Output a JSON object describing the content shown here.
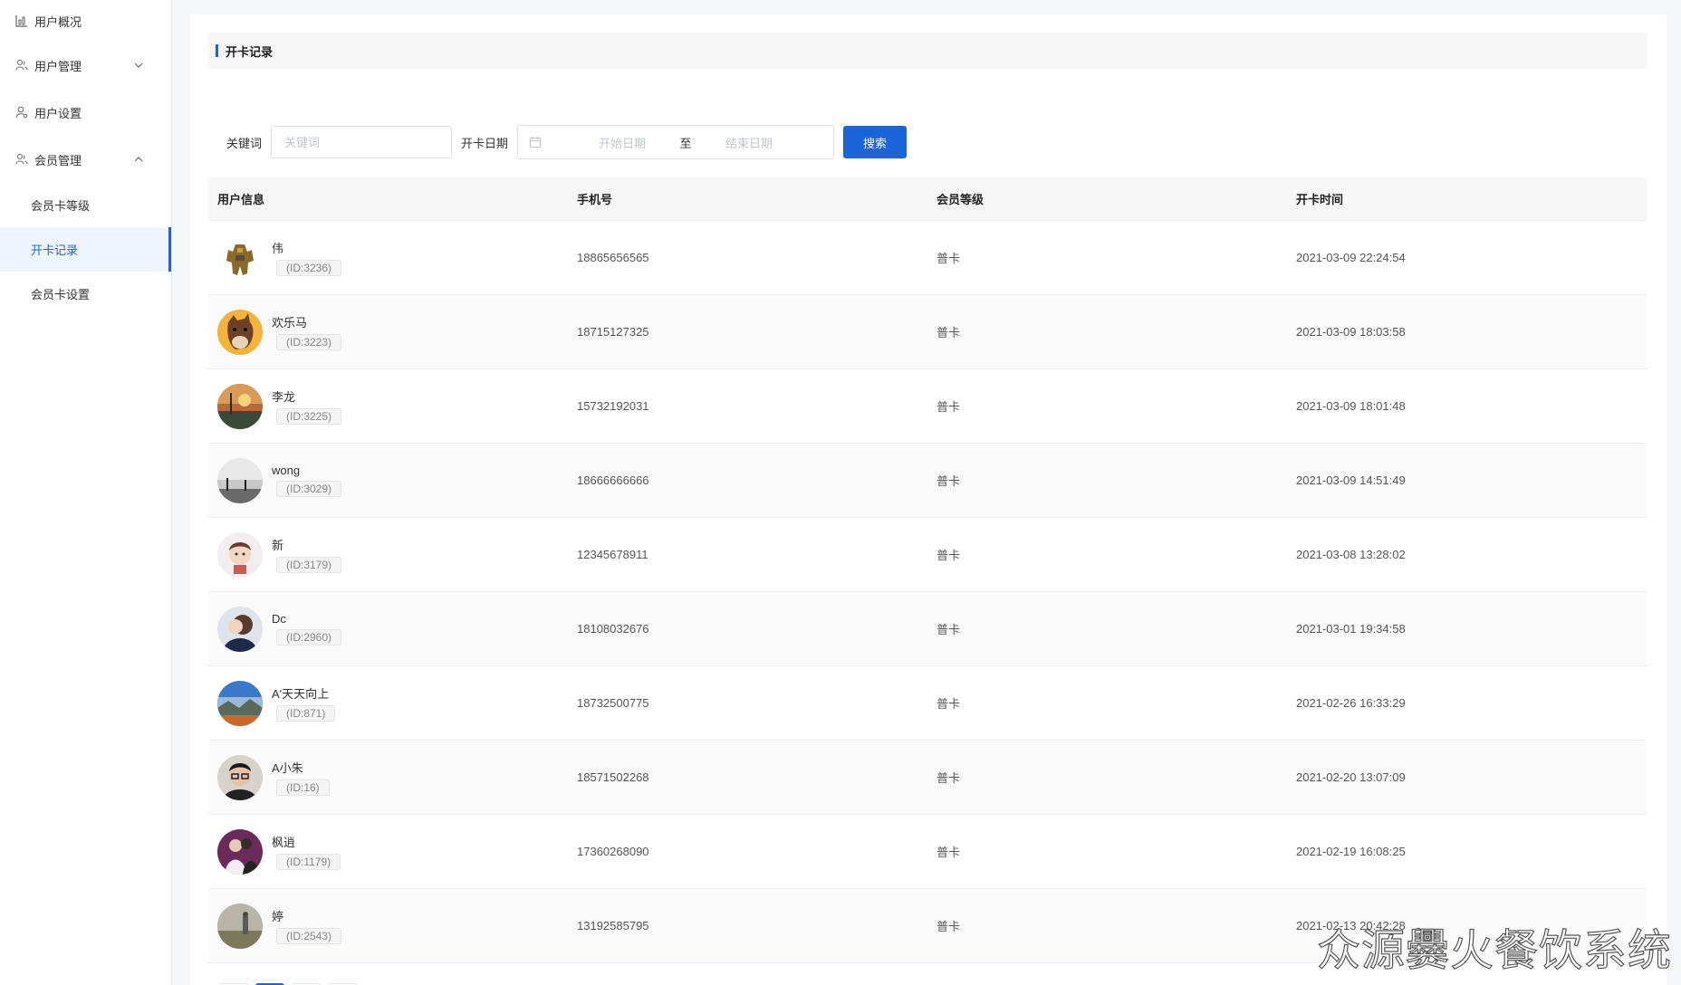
{
  "sidebar": {
    "items": [
      {
        "label": "用户概况",
        "icon": "bar-chart-icon"
      },
      {
        "label": "用户管理",
        "icon": "users-icon",
        "chevron": "down"
      },
      {
        "label": "用户设置",
        "icon": "user-settings-icon"
      },
      {
        "label": "会员管理",
        "icon": "members-icon",
        "chevron": "up"
      }
    ],
    "sub_items": [
      {
        "label": "会员卡等级",
        "active": false
      },
      {
        "label": "开卡记录",
        "active": true
      },
      {
        "label": "会员卡设置",
        "active": false
      }
    ]
  },
  "page_title": "开卡记录",
  "filter": {
    "keyword_label": "关键词",
    "keyword_placeholder": "关键词",
    "date_label": "开卡日期",
    "start_placeholder": "开始日期",
    "to_label": "至",
    "end_placeholder": "结束日期",
    "search_label": "搜索"
  },
  "table": {
    "headers": [
      "用户信息",
      "手机号",
      "会员等级",
      "开卡时间"
    ],
    "rows": [
      {
        "name": "伟",
        "id": "(ID:3236)",
        "phone": "18865656565",
        "level": "普卡",
        "time": "2021-03-09 22:24:54",
        "avatar": "robot"
      },
      {
        "name": "欢乐马",
        "id": "(ID:3223)",
        "phone": "18715127325",
        "level": "普卡",
        "time": "2021-03-09 18:03:58",
        "avatar": "horse"
      },
      {
        "name": "李龙",
        "id": "(ID:3225)",
        "phone": "15732192031",
        "level": "普卡",
        "time": "2021-03-09 18:01:48",
        "avatar": "sunset"
      },
      {
        "name": "wong",
        "id": "(ID:3029)",
        "phone": "18666666666",
        "level": "普卡",
        "time": "2021-03-09 14:51:49",
        "avatar": "lake"
      },
      {
        "name": "新",
        "id": "(ID:3179)",
        "phone": "12345678911",
        "level": "普卡",
        "time": "2021-03-08 13:28:02",
        "avatar": "cartoon"
      },
      {
        "name": "Dc",
        "id": "(ID:2960)",
        "phone": "18108032676",
        "level": "普卡",
        "time": "2021-03-01 19:34:58",
        "avatar": "portrait"
      },
      {
        "name": "A'天天向上",
        "id": "(ID:871)",
        "phone": "18732500775",
        "level": "普卡",
        "time": "2021-02-26 16:33:29",
        "avatar": "landscape"
      },
      {
        "name": "A小朱",
        "id": "(ID:16)",
        "phone": "18571502268",
        "level": "普卡",
        "time": "2021-02-20 13:07:09",
        "avatar": "glasses"
      },
      {
        "name": "枫逍",
        "id": "(ID:1179)",
        "phone": "17360268090",
        "level": "普卡",
        "time": "2021-02-19 16:08:25",
        "avatar": "wedding"
      },
      {
        "name": "婷",
        "id": "(ID:2543)",
        "phone": "13192585795",
        "level": "普卡",
        "time": "2021-02-13 20:42:28",
        "avatar": "field"
      }
    ]
  },
  "watermark": "众源爨火餐饮系统",
  "colors": {
    "accent": "#1c64d9"
  }
}
